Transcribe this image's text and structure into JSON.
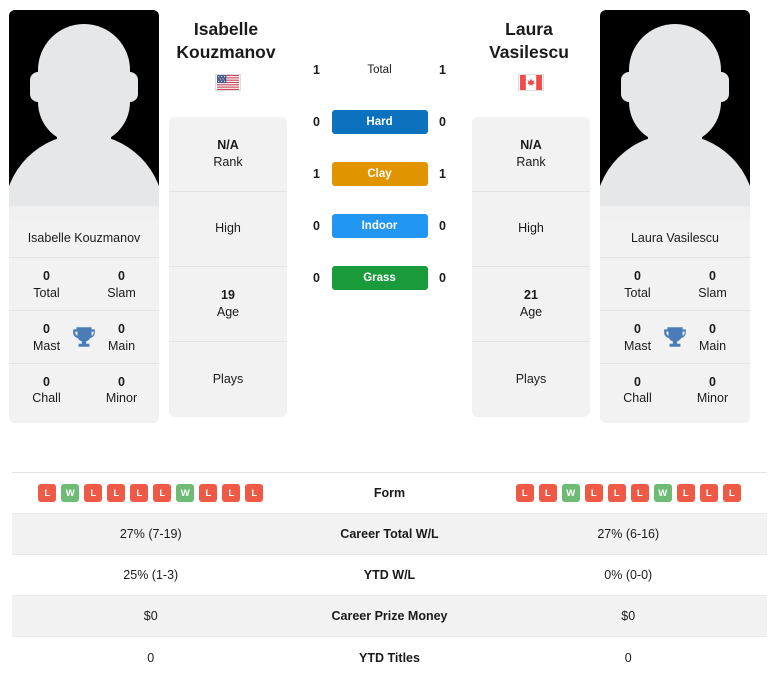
{
  "layout": {
    "colors": {
      "card_bg": "#f2f2f2",
      "divider": "#e4e4e4",
      "trophy": "#4a7cb8",
      "win_badge": "#6dbb74",
      "loss_badge": "#ef5a46"
    }
  },
  "players": {
    "left": {
      "first_name": "Isabelle",
      "last_name": "Kouzmanov",
      "full_name": "Isabelle Kouzmanov",
      "country": "United States",
      "flag_icon": "us-flag-icon",
      "avatar_icon": "player-silhouette-icon",
      "rank_value": "N/A",
      "rank_label": "Rank",
      "high_value": "",
      "high_label": "High",
      "age_value": "19",
      "age_label": "Age",
      "plays_value": "",
      "plays_label": "Plays",
      "titles": [
        {
          "value": "0",
          "label": "Total"
        },
        {
          "value": "0",
          "label": "Slam"
        },
        {
          "value": "0",
          "label": "Mast"
        },
        {
          "value": "0",
          "label": "Main"
        },
        {
          "value": "0",
          "label": "Chall"
        },
        {
          "value": "0",
          "label": "Minor"
        }
      ],
      "form": [
        "L",
        "W",
        "L",
        "L",
        "L",
        "L",
        "W",
        "L",
        "L",
        "L"
      ],
      "career_total_wl": "27% (7-19)",
      "ytd_wl": "25% (1-3)",
      "career_prize_money": "$0",
      "ytd_titles": "0"
    },
    "right": {
      "first_name": "Laura",
      "last_name": "Vasilescu",
      "full_name": "Laura Vasilescu",
      "country": "Canada",
      "flag_icon": "ca-flag-icon",
      "avatar_icon": "player-silhouette-icon",
      "rank_value": "N/A",
      "rank_label": "Rank",
      "high_value": "",
      "high_label": "High",
      "age_value": "21",
      "age_label": "Age",
      "plays_value": "",
      "plays_label": "Plays",
      "titles": [
        {
          "value": "0",
          "label": "Total"
        },
        {
          "value": "0",
          "label": "Slam"
        },
        {
          "value": "0",
          "label": "Mast"
        },
        {
          "value": "0",
          "label": "Main"
        },
        {
          "value": "0",
          "label": "Chall"
        },
        {
          "value": "0",
          "label": "Minor"
        }
      ],
      "form": [
        "L",
        "L",
        "W",
        "L",
        "L",
        "L",
        "W",
        "L",
        "L",
        "L"
      ],
      "career_total_wl": "27% (6-16)",
      "ytd_wl": "0% (0-0)",
      "career_prize_money": "$0",
      "ytd_titles": "0"
    }
  },
  "head_to_head": {
    "rows": [
      {
        "label": "Total",
        "left": "1",
        "right": "1",
        "color": "transparent",
        "is_total": true
      },
      {
        "label": "Hard",
        "left": "0",
        "right": "0",
        "color": "#0c72bd",
        "is_total": false
      },
      {
        "label": "Clay",
        "left": "1",
        "right": "1",
        "color": "#e09400",
        "is_total": false
      },
      {
        "label": "Indoor",
        "left": "0",
        "right": "0",
        "color": "#2196f3",
        "is_total": false
      },
      {
        "label": "Grass",
        "left": "0",
        "right": "0",
        "color": "#199b3c",
        "is_total": false
      }
    ]
  },
  "stats_table": {
    "rows": [
      {
        "label": "Form",
        "type": "form",
        "left": "",
        "right": "",
        "shaded": false
      },
      {
        "label": "Career Total W/L",
        "type": "text",
        "left": "27% (7-19)",
        "right": "27% (6-16)",
        "shaded": true
      },
      {
        "label": "YTD W/L",
        "type": "text",
        "left": "25% (1-3)",
        "right": "0% (0-0)",
        "shaded": false
      },
      {
        "label": "Career Prize Money",
        "type": "text",
        "left": "$0",
        "right": "$0",
        "shaded": true
      },
      {
        "label": "YTD Titles",
        "type": "text",
        "left": "0",
        "right": "0",
        "shaded": false
      }
    ]
  }
}
